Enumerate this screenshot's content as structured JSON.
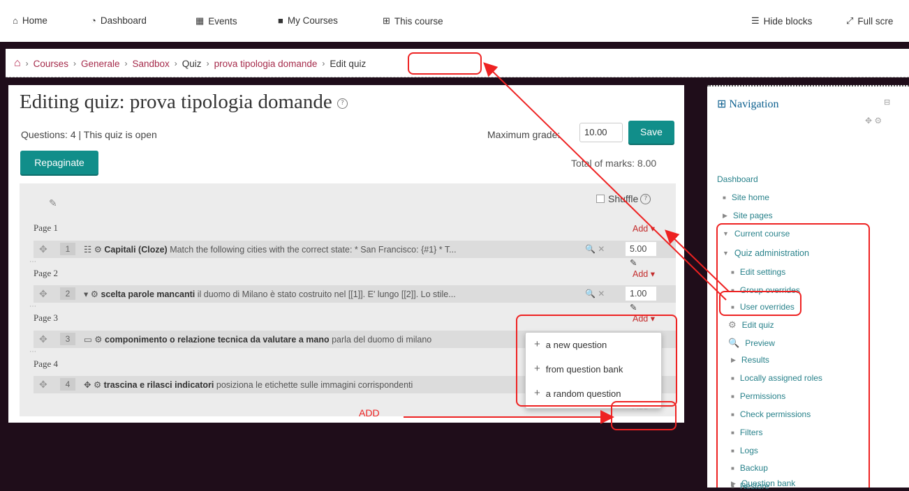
{
  "topbar": {
    "items": [
      {
        "icon": "home-icon",
        "glyph": "🏠",
        "label": "Home"
      },
      {
        "icon": "dashboard-icon",
        "glyph": "◔",
        "label": "Dashboard"
      },
      {
        "icon": "calendar-icon",
        "glyph": "▦",
        "label": "Events"
      },
      {
        "icon": "briefcase-icon",
        "glyph": "■",
        "label": "My Courses"
      },
      {
        "icon": "sitemap-icon",
        "glyph": "⊞",
        "label": "This course"
      }
    ],
    "hide_blocks": "Hide blocks",
    "full_screen": "Full scre"
  },
  "breadcrumb": {
    "items": [
      "Courses",
      "Generale",
      "Sandbox",
      "Quiz",
      "prova tipologia domande"
    ],
    "current": "Edit quiz"
  },
  "quiz": {
    "title": "Editing quiz: prova tipologia domande",
    "info": "Questions: 4 | This quiz is open",
    "max_grade_label": "Maximum grade:",
    "max_grade_value": "10.00",
    "save_label": "Save",
    "repaginate_label": "Repaginate",
    "total_marks": "Total of marks: 8.00",
    "shuffle_label": "Shuffle",
    "add_label": "Add",
    "pages": [
      {
        "label": "Page 1",
        "question": {
          "num": "1",
          "name": "Capitali (Cloze)",
          "text": "Match the following cities with the correct state: * San Francisco: {#1} * T...",
          "mark": "5.00"
        }
      },
      {
        "label": "Page 2",
        "question": {
          "num": "2",
          "name": "scelta parole mancanti",
          "text": "il duomo di Milano è stato costruito nel [[1]]. E' lungo [[2]]. Lo stile...",
          "mark": "1.00"
        }
      },
      {
        "label": "Page 3",
        "question": {
          "num": "3",
          "name": "componimento o relazione tecnica da valutare a mano",
          "text": "parla del duomo di milano",
          "mark": ""
        }
      },
      {
        "label": "Page 4",
        "question": {
          "num": "4",
          "name": "trascina e rilasci indicatori",
          "text": "posiziona le etichette sulle immagini corrispondenti",
          "mark": ""
        }
      }
    ],
    "add_menu": [
      "a new question",
      "from question bank",
      "a random question"
    ]
  },
  "annotation": {
    "add_text": "ADD"
  },
  "navigation": {
    "title": "Navigation",
    "items": [
      {
        "label": "Dashboard",
        "kind": "none"
      },
      {
        "label": "Site home",
        "kind": "bullet"
      },
      {
        "label": "Site pages",
        "kind": "arrow-right"
      },
      {
        "label": "Current course",
        "kind": "arrow-down"
      },
      {
        "label": "Quiz administration",
        "kind": "arrow-down"
      },
      {
        "label": "Edit settings",
        "kind": "bullet"
      },
      {
        "label": "Group overrides",
        "kind": "bullet"
      },
      {
        "label": "User overrides",
        "kind": "bullet"
      },
      {
        "label": "Edit quiz",
        "kind": "gear"
      },
      {
        "label": "Preview",
        "kind": "search"
      },
      {
        "label": "Results",
        "kind": "arrow-right"
      },
      {
        "label": "Locally assigned roles",
        "kind": "bullet"
      },
      {
        "label": "Permissions",
        "kind": "bullet"
      },
      {
        "label": "Check permissions",
        "kind": "bullet"
      },
      {
        "label": "Filters",
        "kind": "bullet"
      },
      {
        "label": "Logs",
        "kind": "bullet"
      },
      {
        "label": "Backup",
        "kind": "bullet"
      },
      {
        "label": "Restore",
        "kind": "bullet"
      },
      {
        "label": "Question bank",
        "kind": "arrow-right"
      }
    ]
  },
  "colors": {
    "accent": "#118e8a",
    "link": "#a52a4a",
    "annotation": "#ee2222",
    "background": "#1f0d1a"
  }
}
